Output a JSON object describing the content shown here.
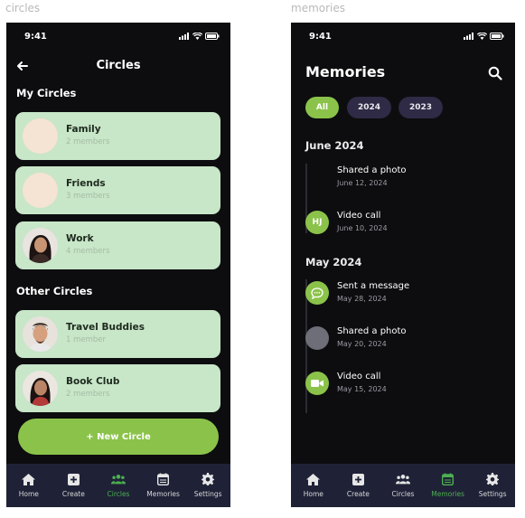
{
  "frames": {
    "left_label": "circles",
    "right_label": "memories"
  },
  "circles_screen": {
    "status_time": "9:41",
    "title": "Circles",
    "my_circles_heading": "My Circles",
    "other_circles_heading": "Other Circles",
    "my_circles": [
      {
        "name": "Family",
        "members": "2 members",
        "avatar": "empty-avatar"
      },
      {
        "name": "Friends",
        "members": "3 members",
        "avatar": "empty-avatar"
      },
      {
        "name": "Work",
        "members": "4 members",
        "avatar": "photo-woman-avatar"
      }
    ],
    "other_circles": [
      {
        "name": "Travel Buddies",
        "members": "1 member",
        "avatar": "photo-man-avatar"
      },
      {
        "name": "Book Club",
        "members": "2 members",
        "avatar": "photo-woman-avatar"
      }
    ],
    "new_circle_label": "+ New Circle",
    "tabs": [
      {
        "label": "Home",
        "icon": "home-icon",
        "active": false
      },
      {
        "label": "Create",
        "icon": "plus-square-icon",
        "active": false
      },
      {
        "label": "Circles",
        "icon": "people-icon",
        "active": true
      },
      {
        "label": "Memories",
        "icon": "calendar-icon",
        "active": false
      },
      {
        "label": "Settings",
        "icon": "gear-icon",
        "active": false
      }
    ]
  },
  "memories_screen": {
    "status_time": "9:41",
    "title": "Memories",
    "filters": [
      {
        "label": "All",
        "active": true
      },
      {
        "label": "2024",
        "active": false
      },
      {
        "label": "2023",
        "active": false
      }
    ],
    "groups": [
      {
        "month": "June 2024",
        "items": [
          {
            "title": "Shared a photo",
            "date": "June 12, 2024",
            "icon": "none"
          },
          {
            "title": "Video call",
            "date": "June 10, 2024",
            "icon": "initials-avatar",
            "initials": "HJ"
          }
        ]
      },
      {
        "month": "May 2024",
        "items": [
          {
            "title": "Sent a message",
            "date": "May 28, 2024",
            "icon": "chat-bubble-icon"
          },
          {
            "title": "Shared a photo",
            "date": "May 20, 2024",
            "icon": "gray-placeholder"
          },
          {
            "title": "Video call",
            "date": "May 15, 2024",
            "icon": "video-camera-icon"
          }
        ]
      }
    ],
    "tabs": [
      {
        "label": "Home",
        "icon": "home-icon",
        "active": false
      },
      {
        "label": "Create",
        "icon": "plus-square-icon",
        "active": false
      },
      {
        "label": "Circles",
        "icon": "people-icon",
        "active": false
      },
      {
        "label": "Memories",
        "icon": "calendar-icon",
        "active": true
      },
      {
        "label": "Settings",
        "icon": "gear-icon",
        "active": false
      }
    ]
  },
  "colors": {
    "accent_green": "#8bc34a",
    "card_green": "#c8e6c8",
    "background_dark": "#0d0d0f",
    "tabbar": "#1f2237",
    "active_tab": "#4caf50"
  }
}
